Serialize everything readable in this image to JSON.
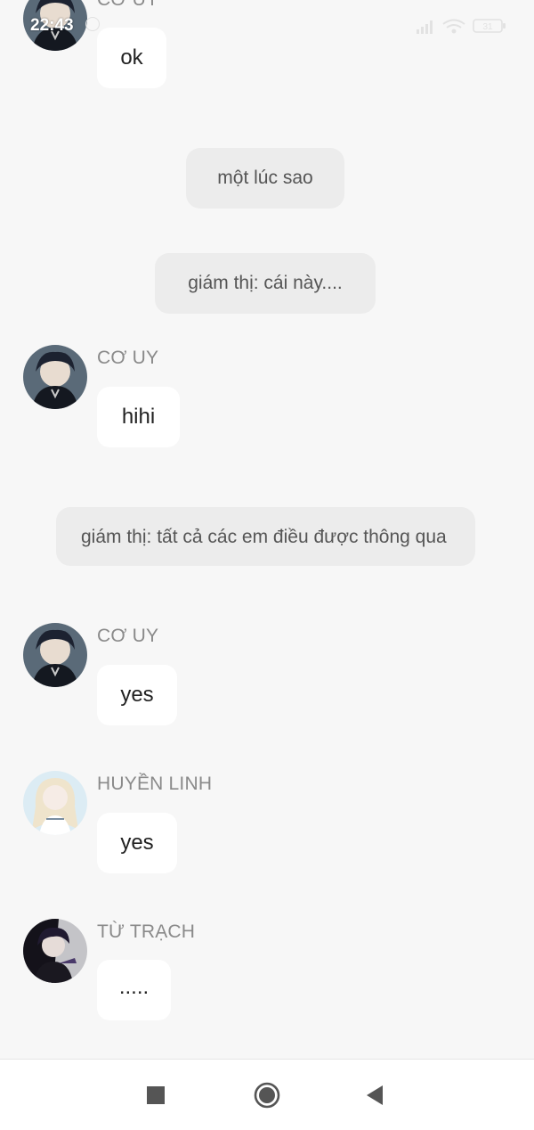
{
  "status_bar": {
    "time": "22:43",
    "battery": "31"
  },
  "messages": [
    {
      "sender": "CƠ UY",
      "text": "ok"
    },
    {
      "system": "một lúc sao"
    },
    {
      "system": "giám thị: cái này...."
    },
    {
      "sender": "CƠ UY",
      "text": "hihi"
    },
    {
      "system": "giám thị: tất cả các em điều được thông qua"
    },
    {
      "sender": "CƠ UY",
      "text": "yes"
    },
    {
      "sender": "HUYỀN LINH",
      "text": "yes"
    },
    {
      "sender": "TỪ TRẠCH",
      "text": "....."
    }
  ],
  "icons": {
    "status": [
      "notification-icon",
      "signal-icon",
      "wifi-icon",
      "battery-icon"
    ],
    "nav": [
      "recents-square-icon",
      "home-circle-icon",
      "back-triangle-icon"
    ]
  },
  "colors": {
    "background": "#f7f7f7",
    "bubble": "#ffffff",
    "system_bubble": "#ececec",
    "sender_name": "#8a8a8a"
  }
}
